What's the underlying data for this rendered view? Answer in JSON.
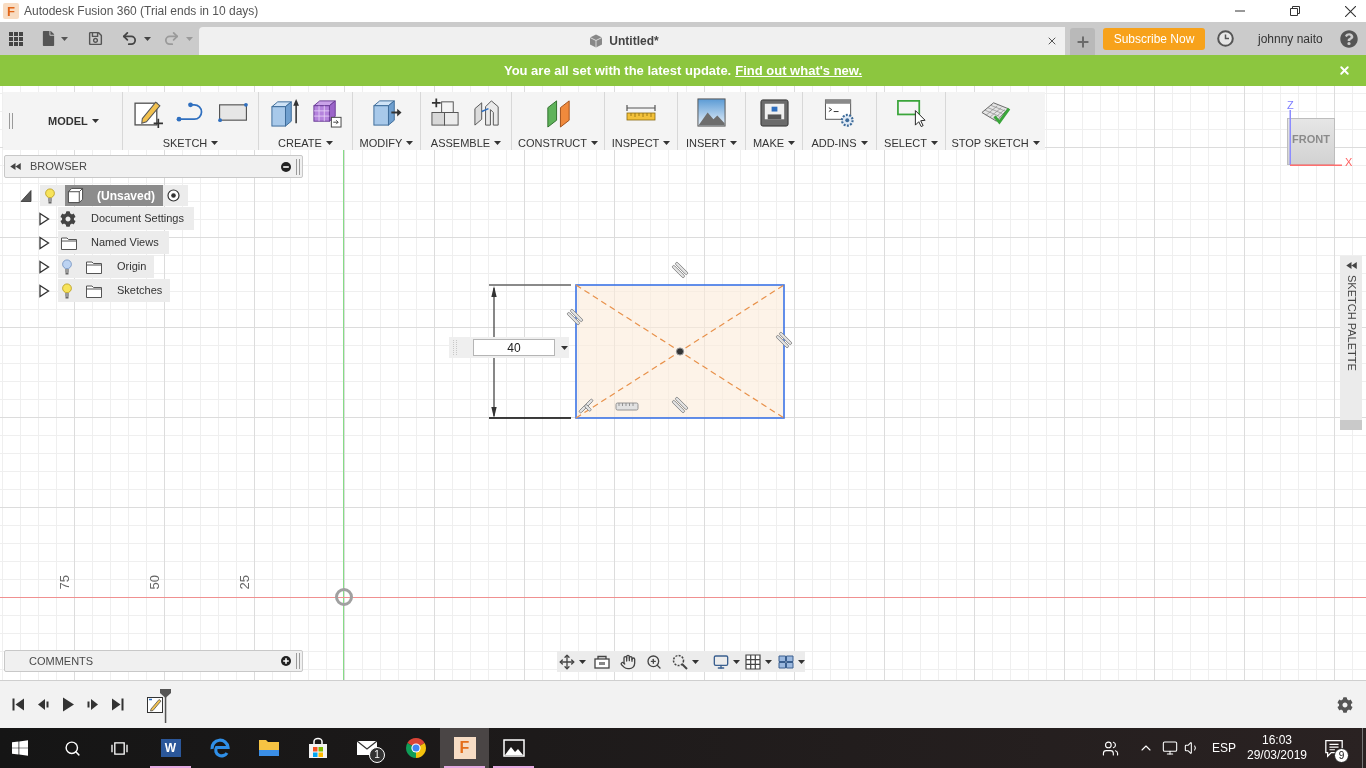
{
  "title_bar": {
    "app_icon_letter": "F",
    "title": "Autodesk Fusion 360 (Trial ends in 10 days)"
  },
  "tab_bar": {
    "undo": {
      "disabled": false
    },
    "redo": {
      "disabled": true
    },
    "document_tab": {
      "title": "Untitled*"
    },
    "subscribe_button": "Subscribe Now",
    "user_name": "johnny naito"
  },
  "banner": {
    "message": "You are all set with the latest update.",
    "link": "Find out what's new."
  },
  "toolbar": {
    "workspace": "MODEL",
    "groups": [
      {
        "kind": "sketch",
        "label": "SKETCH"
      },
      {
        "kind": "create",
        "label": "CREATE"
      },
      {
        "kind": "modify",
        "label": "MODIFY"
      },
      {
        "kind": "assemble",
        "label": "ASSEMBLE"
      },
      {
        "kind": "construct",
        "label": "CONSTRUCT"
      },
      {
        "kind": "inspect",
        "label": "INSPECT"
      },
      {
        "kind": "insert",
        "label": "INSERT"
      },
      {
        "kind": "make",
        "label": "MAKE"
      },
      {
        "kind": "addins",
        "label": "ADD-INS"
      },
      {
        "kind": "select",
        "label": "SELECT"
      },
      {
        "kind": "stop_sketch",
        "label": "STOP SKETCH"
      }
    ]
  },
  "browser": {
    "title": "BROWSER",
    "tree": [
      {
        "kind": "component",
        "label": "(Unsaved)",
        "expanded": true,
        "visible": true,
        "children": [
          {
            "kind": "settings",
            "label": "Document Settings",
            "expanded": false
          },
          {
            "kind": "views",
            "label": "Named Views",
            "expanded": false
          },
          {
            "kind": "folder",
            "label": "Origin",
            "expanded": false,
            "visible": false
          },
          {
            "kind": "folder",
            "label": "Sketches",
            "expanded": false,
            "visible": true
          }
        ]
      }
    ]
  },
  "viewcube": {
    "face": "FRONT",
    "z_label": "Z",
    "x_label": "X"
  },
  "sketch_palette": {
    "title": "SKETCH PALETTE"
  },
  "ruler_labels": [
    "75",
    "50",
    "25"
  ],
  "sketch": {
    "dimension_input": {
      "value": "40"
    }
  },
  "comments": {
    "title": "COMMENTS"
  },
  "taskbar": {
    "apps": [
      {
        "kind": "word",
        "icon_letter": "W",
        "running": true,
        "selected": false
      },
      {
        "kind": "edge",
        "running": false,
        "selected": false
      },
      {
        "kind": "explorer",
        "running": false,
        "selected": false
      },
      {
        "kind": "store",
        "running": false,
        "selected": false
      },
      {
        "kind": "mail",
        "badge": "1",
        "running": false,
        "selected": false
      },
      {
        "kind": "chrome",
        "running": false,
        "selected": false
      },
      {
        "kind": "fusion",
        "icon_letter": "F",
        "running": true,
        "selected": true
      },
      {
        "kind": "photos",
        "running": true,
        "selected": false
      }
    ],
    "language": "ESP",
    "time": "16:03",
    "date": "29/03/2019",
    "notification_count": "9"
  }
}
